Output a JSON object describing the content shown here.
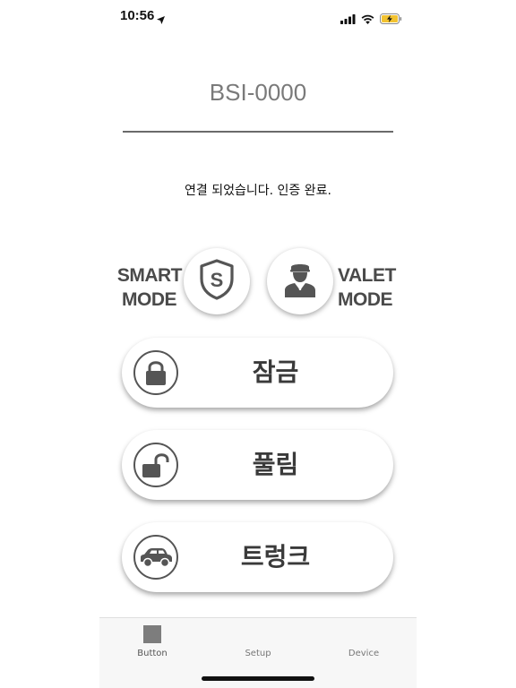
{
  "status_bar": {
    "time": "10:56"
  },
  "device": {
    "name": "BSI-0000"
  },
  "connection": {
    "message": "연결 되었습니다. 인증 완료."
  },
  "modes": {
    "smart": {
      "line1": "SMART",
      "line2": "MODE",
      "icon": "shield-s-icon"
    },
    "valet": {
      "line1": "VALET",
      "line2": "MODE",
      "icon": "valet-person-icon"
    }
  },
  "actions": [
    {
      "label": "잠금",
      "icon": "lock-icon"
    },
    {
      "label": "풀림",
      "icon": "unlock-icon"
    },
    {
      "label": "트렁크",
      "icon": "car-trunk-icon"
    }
  ],
  "tabs": [
    {
      "label": "Button",
      "active": true
    },
    {
      "label": "Setup",
      "active": false
    },
    {
      "label": "Device",
      "active": false
    }
  ]
}
